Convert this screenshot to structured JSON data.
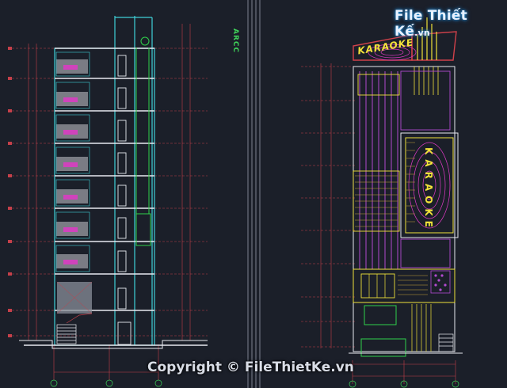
{
  "watermark": {
    "logo_text": "File Thiết Kế",
    "logo_tld": ".vn",
    "copyright": "Copyright © FileThietKe.vn"
  },
  "drawing": {
    "side_title": "ARCC",
    "sign_horizontal": "KARAOKE",
    "sign_vertical": "KARAOKE"
  },
  "colors": {
    "background": "#1b1f29",
    "structure_cyan": "#3fd0d8",
    "dimension_red": "#d0414a",
    "wall_white": "#e7e9ef",
    "accent_green": "#2fd24a",
    "facade_yellow": "#efe23a",
    "facade_purple": "#b24ad0",
    "facade_magenta": "#e03ac6",
    "grey_fill": "#8a8f99"
  }
}
